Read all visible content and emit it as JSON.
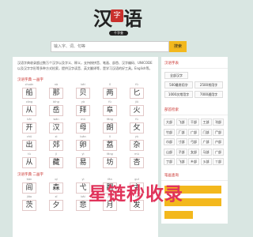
{
  "logo": {
    "left": "汉",
    "seal": "字",
    "right": "语",
    "sub": "千字查"
  },
  "search": {
    "placeholder": "输入字、词、句等",
    "button": "搜索"
  },
  "intro": "汉语字典收录超过数万个汉字以及字义、释义，支持按拼音、笔画、部首、汉字编码、UNICODE 以及汉字字形等多种方式检索，提供汉字读音、英文翻译等，是学习汉语的好工具。English等。",
  "sections": [
    {
      "title": "汉语字典 一画字",
      "chars": [
        {
          "py": "chuán",
          "ch": "船"
        },
        {
          "py": "nà",
          "ch": "那"
        },
        {
          "py": "bèi",
          "ch": "贝"
        },
        {
          "py": "lǐ",
          "ch": "两"
        },
        {
          "py": "fǔ",
          "ch": "匕"
        },
        {
          "py": "cóng",
          "ch": "从"
        },
        {
          "py": "bīng",
          "ch": "岳"
        },
        {
          "py": "yà",
          "ch": "拜"
        },
        {
          "py": "fù",
          "ch": "阜"
        },
        {
          "py": "jiǔ",
          "ch": "火"
        },
        {
          "py": "kāi",
          "ch": "开"
        },
        {
          "py": "wǎn",
          "ch": "汉"
        },
        {
          "py": "mǔ",
          "ch": "母"
        },
        {
          "py": "fāng",
          "ch": "朗"
        },
        {
          "py": "fù",
          "ch": "攵"
        },
        {
          "py": "chū",
          "ch": "出"
        },
        {
          "py": "xì",
          "ch": "郊"
        },
        {
          "py": "luǎn",
          "ch": "卵"
        },
        {
          "py": "lì",
          "ch": "荔"
        },
        {
          "py": "yù",
          "ch": "杂"
        },
        {
          "py": "tǔ",
          "ch": "从"
        },
        {
          "py": "jì",
          "ch": "藏"
        },
        {
          "py": "yì",
          "ch": "易"
        },
        {
          "py": "fāng",
          "ch": "坊"
        },
        {
          "py": "mù",
          "ch": "杏"
        }
      ]
    },
    {
      "title": "汉语字典 二画字",
      "chars": [
        {
          "py": "tián",
          "ch": "闾"
        },
        {
          "py": "qí",
          "ch": "森"
        },
        {
          "py": "yì",
          "ch": "弋"
        },
        {
          "py": "fān",
          "ch": "翻"
        },
        {
          "py": "guī",
          "ch": "主"
        },
        {
          "py": "jiāo",
          "ch": "茨"
        },
        {
          "py": "xī",
          "ch": "夕"
        },
        {
          "py": "bǎi",
          "ch": "悲"
        },
        {
          "py": "yuè",
          "ch": "月"
        },
        {
          "py": "fā",
          "ch": "发"
        }
      ]
    }
  ],
  "side": {
    "groups": [
      {
        "title": "汉语字表",
        "items": [
          "全部汉字",
          "500最常用字",
          "2500常用字",
          "1000次常用字",
          "7000通用字"
        ]
      },
      {
        "title": "部首检索",
        "items": [
          "大部",
          "飞部",
          "干部",
          "工部",
          "刊部",
          "竹部",
          "厂部",
          "广部",
          "门部",
          "尸部",
          "巾部",
          "寸部",
          "弓部",
          "广部",
          "户部",
          "山部",
          "子部",
          "女部",
          "马部",
          "广部",
          "丁部",
          "飞部",
          "乡部",
          "彡部",
          "丫部"
        ]
      },
      {
        "title": "笔画查询",
        "items": []
      }
    ]
  },
  "watermark": "星链秒收录"
}
